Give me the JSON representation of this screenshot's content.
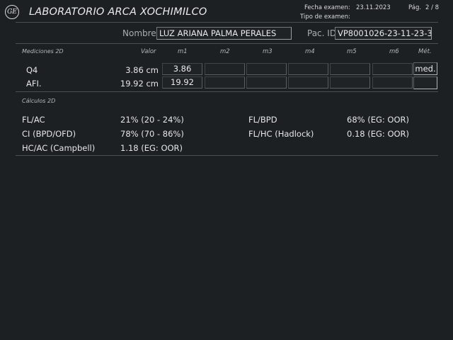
{
  "header": {
    "logo_text": "GE",
    "title": "LABORATORIO ARCA XOCHIMILCO",
    "exam_date_label": "Fecha examen:",
    "exam_date_value": "23.11.2023",
    "page_label": "Pág.",
    "page_value": "2 / 8",
    "exam_type_label": "Tipo de examen:"
  },
  "patient": {
    "name_label": "Nombre",
    "name_value": "LUZ ARIANA PALMA PERALES",
    "id_label": "Pac. ID",
    "id_value": "VP8001026-23-11-23-3"
  },
  "measurements": {
    "section_title": "Mediciones 2D",
    "columns": {
      "valor": "Valor",
      "m1": "m1",
      "m2": "m2",
      "m3": "m3",
      "m4": "m4",
      "m5": "m5",
      "m6": "m6",
      "met": "Mét."
    },
    "rows": [
      {
        "label": "Q4",
        "value": "3.86 cm",
        "m1": "3.86",
        "m2": "",
        "m3": "",
        "m4": "",
        "m5": "",
        "m6": "",
        "met": "med."
      },
      {
        "label": "AFI.",
        "value": "19.92 cm",
        "m1": "19.92",
        "m2": "",
        "m3": "",
        "m4": "",
        "m5": "",
        "m6": "",
        "met": ""
      }
    ]
  },
  "calculations": {
    "section_title": "Cálculos 2D",
    "items": [
      {
        "label": "FL/AC",
        "value": "21% (20 - 24%)"
      },
      {
        "label": "FL/BPD",
        "value": "68% (EG: OOR)"
      },
      {
        "label": "CI (BPD/OFD)",
        "value": "78% (70 - 86%)"
      },
      {
        "label": "FL/HC (Hadlock)",
        "value": "0.18 (EG: OOR)"
      },
      {
        "label": "HC/AC (Campbell)",
        "value": "1.18 (EG: OOR)"
      }
    ]
  }
}
